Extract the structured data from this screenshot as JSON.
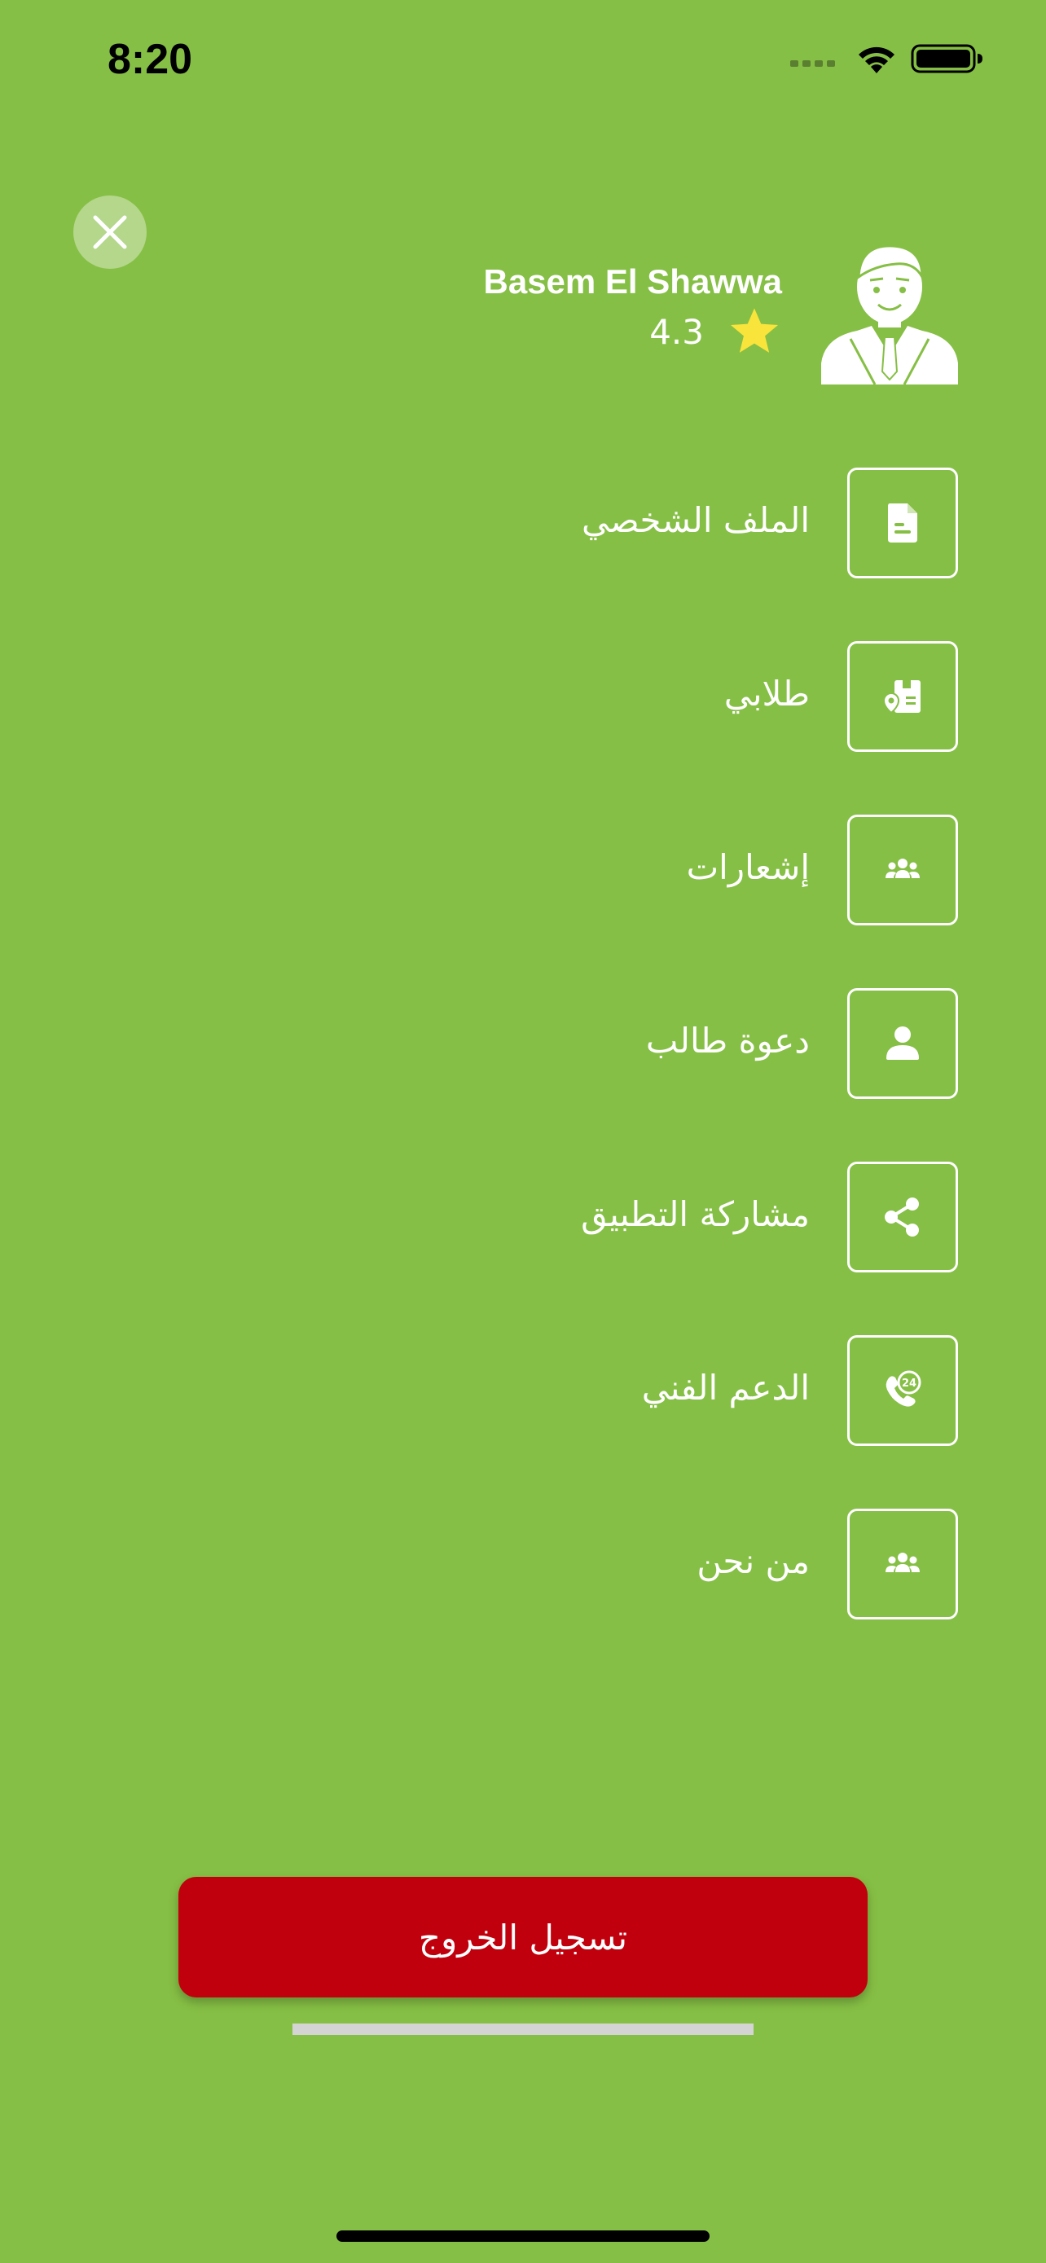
{
  "status_bar": {
    "time": "8:20",
    "icons": [
      "signal-icon",
      "wifi-icon",
      "battery-icon"
    ]
  },
  "drawer": {
    "close_icon": "close-icon",
    "user": {
      "name": "Basem El Shawwa",
      "rating": "4.3",
      "rating_icon": "star-icon",
      "avatar_icon": "avatar-icon"
    },
    "menu_items": [
      {
        "label": "الملف الشخصي",
        "icon": "document-icon"
      },
      {
        "label": "طلابي",
        "icon": "delivery-box-icon"
      },
      {
        "label": "إشعارات",
        "icon": "people-group-icon"
      },
      {
        "label": "دعوة طالب",
        "icon": "person-icon"
      },
      {
        "label": "مشاركة التطبيق",
        "icon": "share-icon"
      },
      {
        "label": "الدعم الفني",
        "icon": "support-24-icon"
      },
      {
        "label": "من نحن",
        "icon": "people-group-icon"
      }
    ],
    "logout_label": "تسجيل الخروج"
  },
  "colors": {
    "background": "#86bf45",
    "logout": "#c0000d",
    "star": "#f9e43c"
  }
}
